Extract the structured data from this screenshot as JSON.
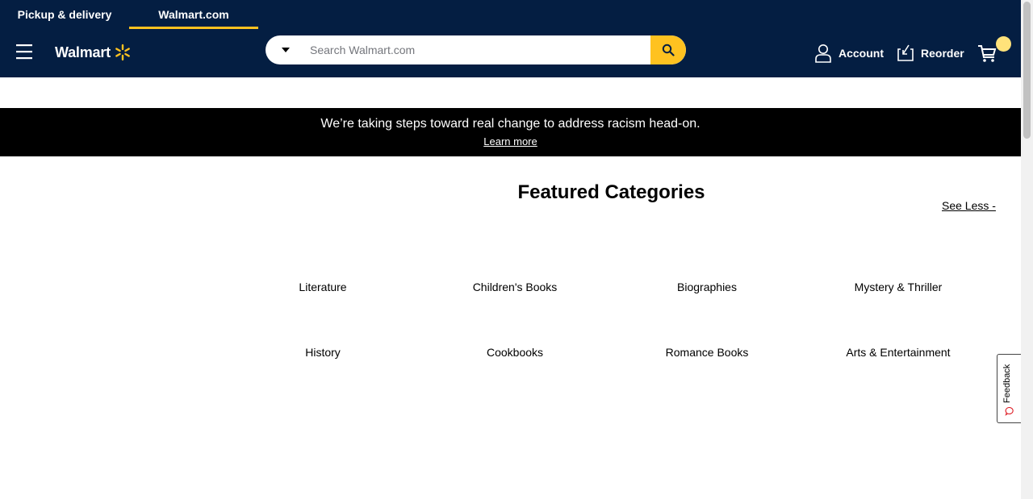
{
  "header": {
    "tabs": [
      {
        "label": "Pickup & delivery"
      },
      {
        "label": "Walmart.com"
      }
    ],
    "logo_text": "Walmart",
    "search": {
      "placeholder": "Search Walmart.com",
      "value": ""
    },
    "account_label": "Account",
    "reorder_label": "Reorder",
    "colors": {
      "background": "#041e42",
      "accent": "#ffc220"
    }
  },
  "banner": {
    "text": "We’re taking steps toward real change to address racism head-on.",
    "link": "Learn more"
  },
  "featured": {
    "title": "Featured Categories",
    "toggle": "See Less -",
    "categories": [
      {
        "label": "Literature"
      },
      {
        "label": "Children's Books"
      },
      {
        "label": "Biographies"
      },
      {
        "label": "Mystery & Thriller"
      },
      {
        "label": "History"
      },
      {
        "label": "Cookbooks"
      },
      {
        "label": "Romance Books"
      },
      {
        "label": "Arts & Entertainment"
      }
    ]
  },
  "feedback": {
    "label": "Feedback"
  },
  "icons": {
    "menu": "hamburger-menu-icon",
    "spark": "walmart-spark-icon",
    "dropdown": "caret-down-icon",
    "search": "search-icon",
    "account": "person-icon",
    "reorder": "reorder-icon",
    "cart": "cart-icon",
    "feedback": "chat-bubble-icon"
  }
}
